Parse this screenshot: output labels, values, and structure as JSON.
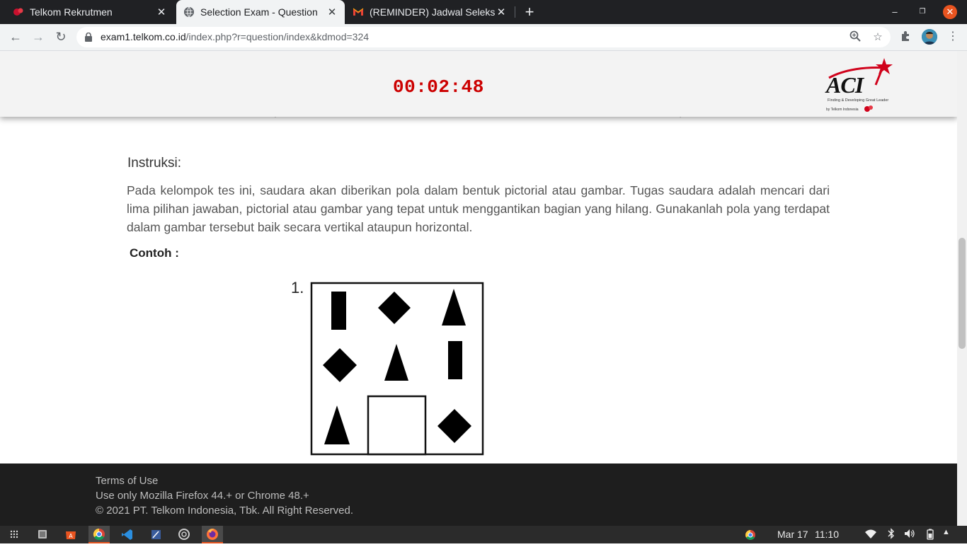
{
  "browser": {
    "tabs": [
      {
        "title": "Telkom Rekrutmen",
        "active": false
      },
      {
        "title": "Selection Exam - Question",
        "active": true
      },
      {
        "title": "(REMINDER) Jadwal Seleksi",
        "active": false
      }
    ],
    "new_tab_label": "+",
    "url_host": "exam1.telkom.co.id",
    "url_path": "/index.php?r=question/index&kdmod=324"
  },
  "exam": {
    "timer": "00:02:48",
    "logo_text": "ACI",
    "logo_tagline": "Finding & Developing Great Leader",
    "logo_by": "by Telkom Indonesia"
  },
  "content": {
    "instruction_heading": "Instruksi:",
    "instruction_text": "Pada kelompok tes ini, saudara akan diberikan pola dalam bentuk pictorial atau gambar. Tugas saudara adalah mencari dari lima pilihan jawaban, pictorial atau gambar yang tepat untuk menggantikan bagian yang hilang. Gunakanlah pola yang terdapat dalam gambar tersebut baik secara vertikal ataupun horizontal.",
    "example_label": "Contoh :",
    "puzzle_number": "1.",
    "puzzle_grid": [
      [
        "rectangle",
        "diamond",
        "triangle"
      ],
      [
        "diamond",
        "triangle",
        "rectangle"
      ],
      [
        "triangle",
        "empty",
        "diamond"
      ]
    ]
  },
  "footer": {
    "terms": "Terms of Use",
    "browser_note": "Use only Mozilla Firefox 44.+ or Chrome 48.+",
    "copyright": "© 2021 PT. Telkom Indonesia, Tbk. All Right Reserved."
  },
  "taskbar": {
    "apps": [
      "app-grid-icon",
      "files-icon",
      "software-store-icon",
      "chrome-icon",
      "vscode-icon",
      "editor-icon",
      "disc-icon",
      "firefox-icon"
    ],
    "date": "Mar 17",
    "time": "11:10"
  },
  "colors": {
    "timer": "#cc0000",
    "tabstrip": "#202124",
    "footer": "#1e1e1e",
    "accent": "#e95420"
  }
}
